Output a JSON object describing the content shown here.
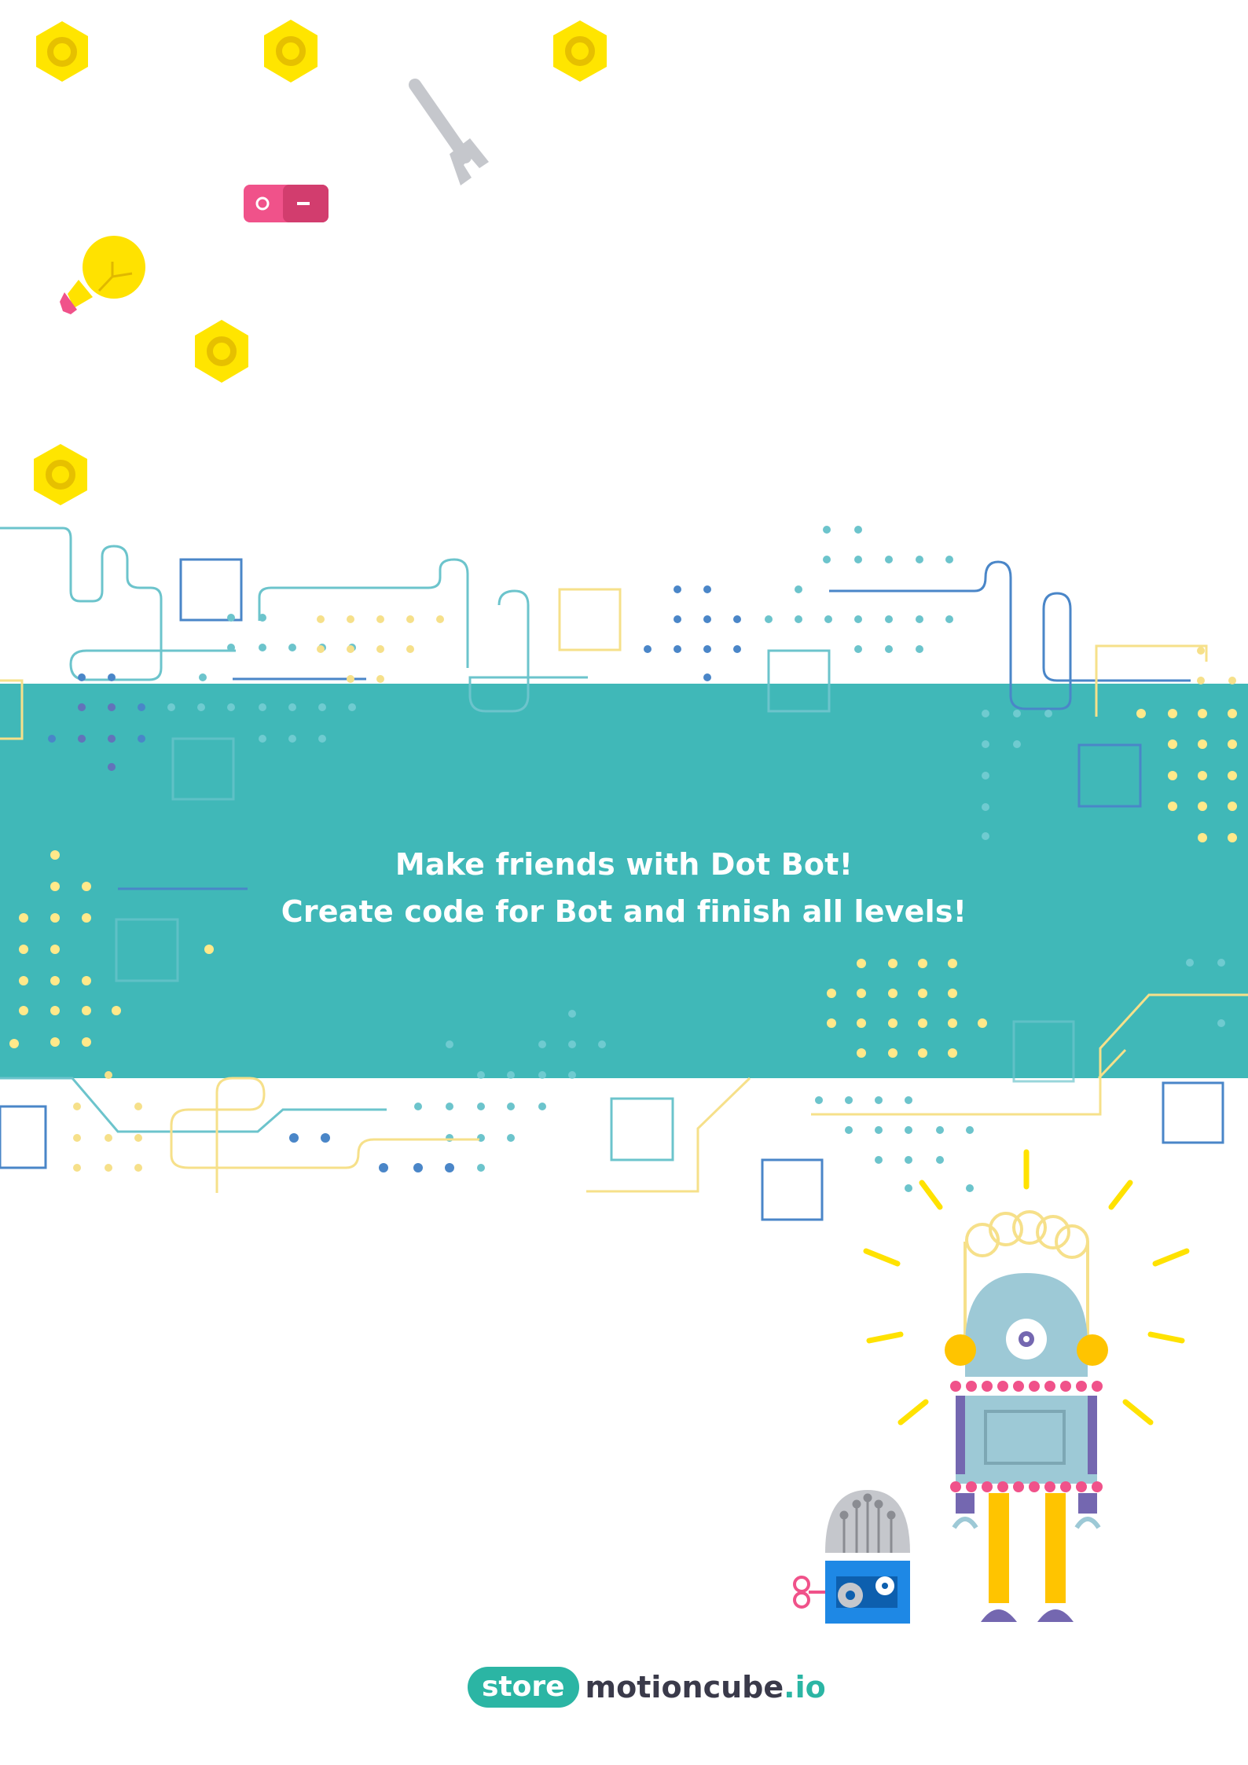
{
  "colors": {
    "teal": "#40b8b8",
    "yellow": "#ffe200",
    "blue": "#4a86c8",
    "light_teal": "#6cc4cc",
    "pale_yellow": "#f6e08a",
    "pink": "#f0528a",
    "purple": "#7467b0",
    "gray": "#c5c7cc",
    "robot_body": "#9dc9d6"
  },
  "headline": {
    "line1": "Make friends with Dot Bot!",
    "line2": "Create code for Bot and finish all levels!"
  },
  "brand": {
    "pill": "store",
    "name": "motioncube",
    "tld": ".io"
  },
  "icons": [
    "hex-nut-icon",
    "wrench-icon",
    "switch-icon",
    "light-bulb-icon",
    "robot-icon",
    "small-robot-icon",
    "gear-icon"
  ]
}
